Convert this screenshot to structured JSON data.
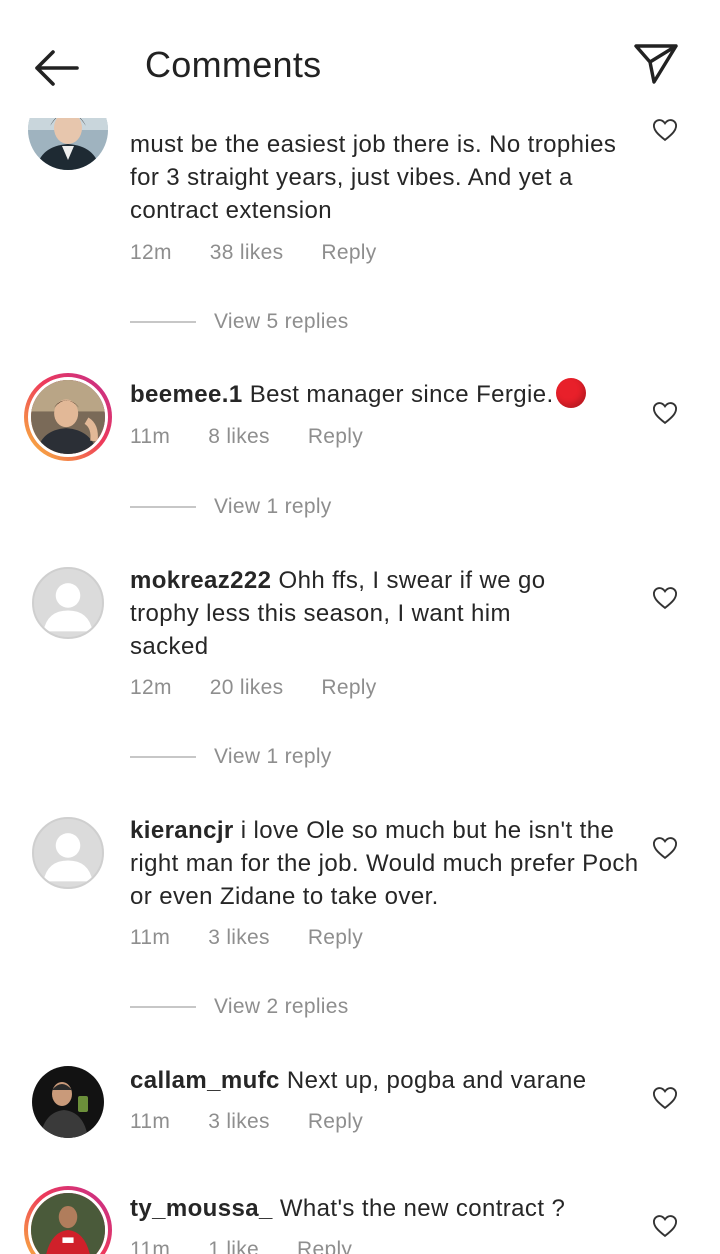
{
  "header": {
    "title": "Comments",
    "back_icon": "arrow-left-icon",
    "send_icon": "paper-plane-icon"
  },
  "comments": [
    {
      "username": "",
      "text": "must be the easiest job there is. No trophies for 3 straight years, just vibes. And yet a contract extension",
      "time": "12m",
      "likes": "38 likes",
      "reply": "Reply",
      "view_replies": "View 5 replies"
    },
    {
      "username": "beemee.1",
      "text": "Best manager since Fergie.",
      "emoji": "red-circle",
      "time": "11m",
      "likes": "8 likes",
      "reply": "Reply",
      "view_replies": "View 1 reply"
    },
    {
      "username": "mokreaz222",
      "text": "Ohh ffs, I swear if we go trophy less this season, I want him sacked",
      "time": "12m",
      "likes": "20 likes",
      "reply": "Reply",
      "view_replies": "View 1 reply"
    },
    {
      "username": "kierancjr",
      "text": "i love Ole so much but he isn't the right man for the job. Would much prefer Poch or even Zidane to take over.",
      "time": "11m",
      "likes": "3 likes",
      "reply": "Reply",
      "view_replies": "View 2 replies"
    },
    {
      "username": "callam_mufc",
      "text": "Next up, pogba and varane",
      "time": "11m",
      "likes": "3 likes",
      "reply": "Reply"
    },
    {
      "username": "ty_moussa_",
      "text": "What's the new contract ?",
      "time": "11m",
      "likes": "1 like",
      "reply": "Reply"
    }
  ],
  "colors": {
    "text": "#262626",
    "meta": "#8e8e8e",
    "story_ring_start": "#f9c33c",
    "story_ring_end": "#c02c8f",
    "emoji_red": "#e8202a"
  }
}
